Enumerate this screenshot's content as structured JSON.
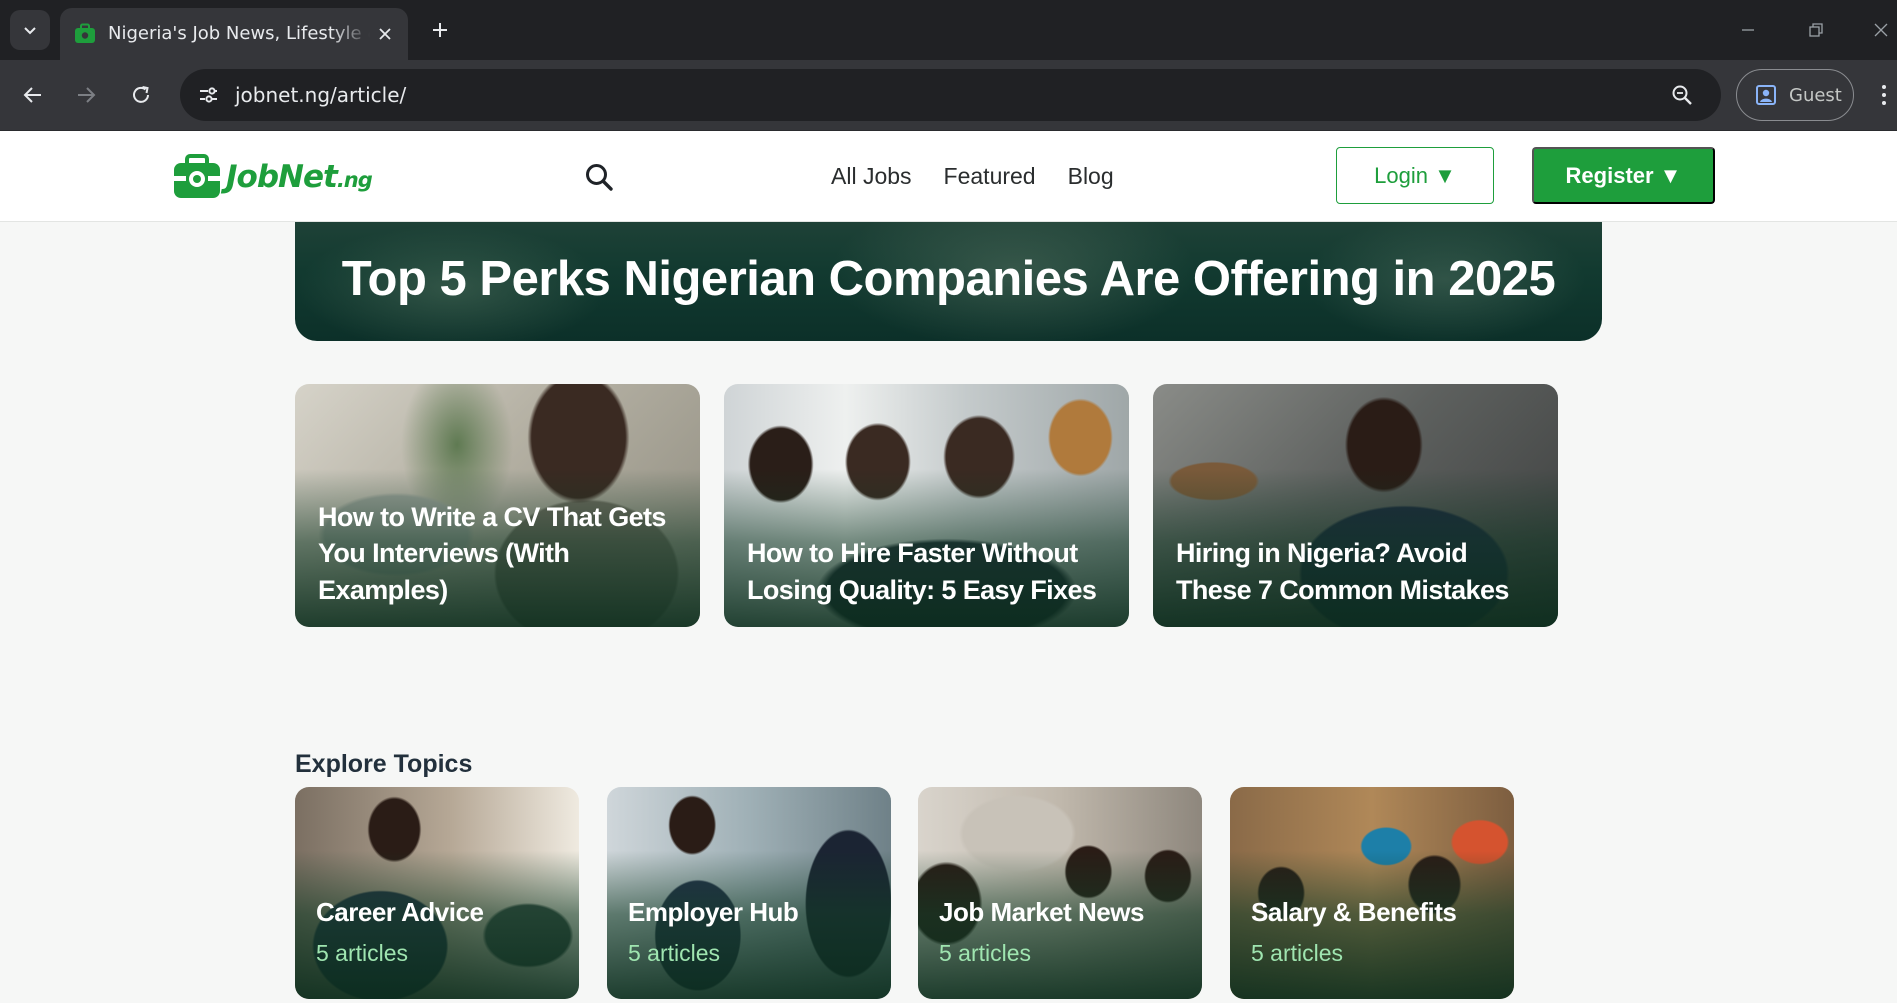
{
  "browser": {
    "tab_title": "Nigeria's Job News, Lifestyle & Career Tips",
    "url": "jobnet.ng/article/",
    "profile_label": "Guest"
  },
  "header": {
    "logo_main": "JobNet",
    "logo_suffix": ".ng",
    "nav": [
      "All Jobs",
      "Featured",
      "Blog"
    ],
    "login_label": "Login ▼",
    "register_label": "Register ▼"
  },
  "hero": {
    "title": "Top 5 Perks Nigerian Companies Are Offering in 2025"
  },
  "articles": [
    {
      "title": "How to Write a CV That Gets You Interviews (With Examples)"
    },
    {
      "title": "How to Hire Faster Without Losing Quality: 5 Easy Fixes"
    },
    {
      "title": "Hiring in Nigeria? Avoid These 7 Common Mistakes"
    }
  ],
  "topics_section": {
    "title": "Explore Topics",
    "topics": [
      {
        "name": "Career Advice",
        "count": "5 articles"
      },
      {
        "name": "Employer Hub",
        "count": "5 articles"
      },
      {
        "name": "Job Market News",
        "count": "5 articles"
      },
      {
        "name": "Salary & Benefits",
        "count": "5 articles"
      }
    ]
  },
  "colors": {
    "brand_green": "#1e9e3c",
    "chrome_dark": "#202124",
    "chrome_toolbar": "#35363a",
    "topic_count_green": "#9fe5b0"
  },
  "icons": [
    "tab-search-icon",
    "briefcase-favicon",
    "close-icon",
    "plus-icon",
    "minimize-icon",
    "restore-icon",
    "window-close-icon",
    "back-arrow-icon",
    "forward-arrow-icon",
    "reload-icon",
    "site-info-icon",
    "zoom-icon",
    "profile-icon",
    "kebab-menu-icon",
    "briefcase-logo-icon",
    "search-icon"
  ]
}
